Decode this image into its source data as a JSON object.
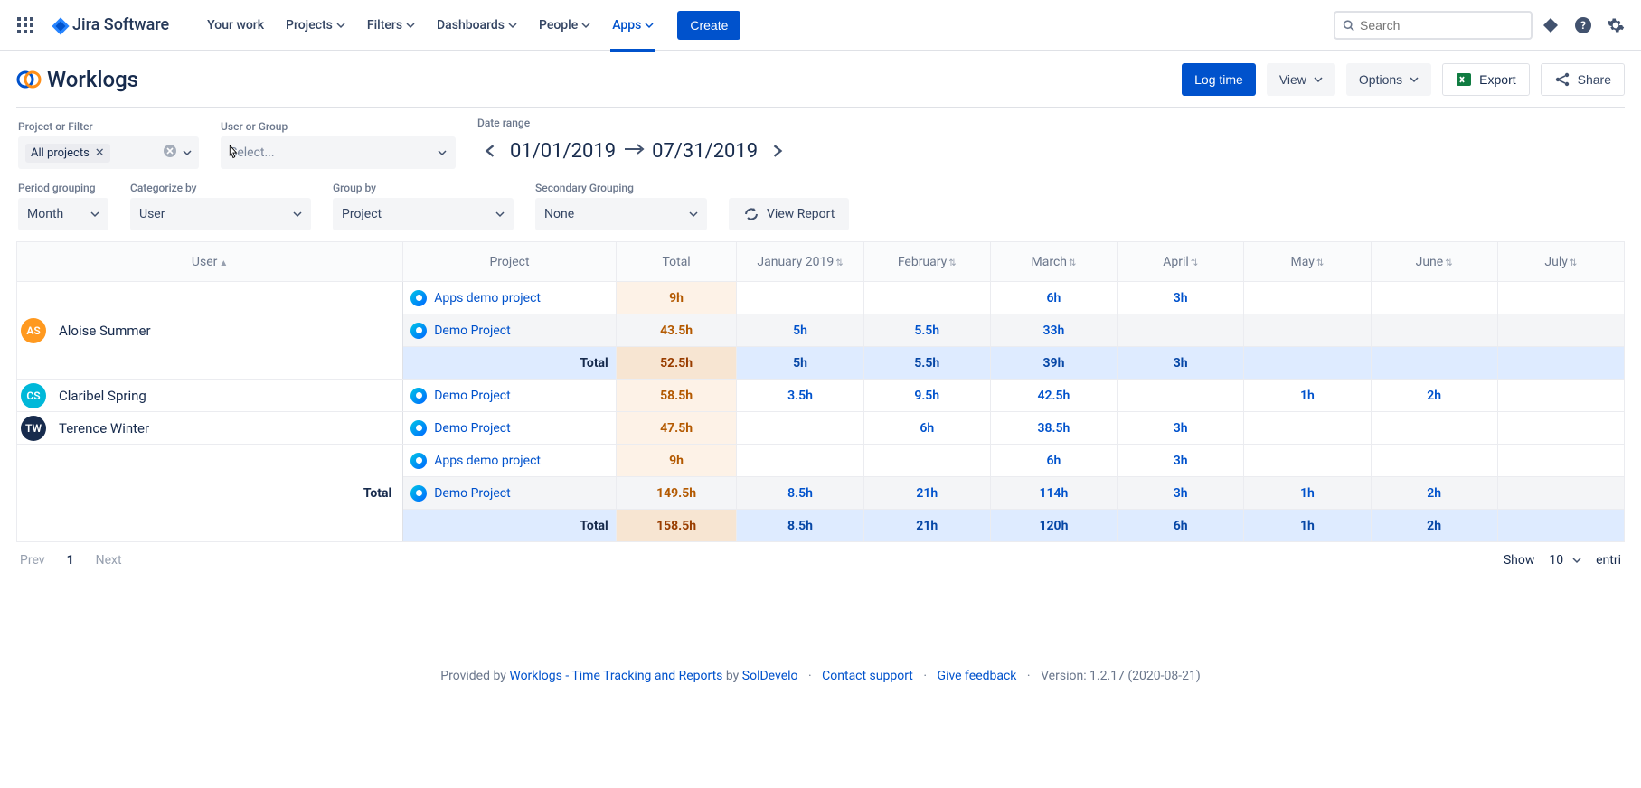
{
  "nav": {
    "product_name": "Jira Software",
    "links": {
      "your_work": "Your work",
      "projects": "Projects",
      "filters": "Filters",
      "dashboards": "Dashboards",
      "people": "People",
      "apps": "Apps"
    },
    "create": "Create",
    "search_placeholder": "Search"
  },
  "header": {
    "title": "Worklogs",
    "actions": {
      "log_time": "Log time",
      "view": "View",
      "options": "Options",
      "export": "Export",
      "share": "Share"
    }
  },
  "toolbar": {
    "project_filter_label": "Project or Filter",
    "project_filter_chip": "All projects",
    "user_group_label": "User or Group",
    "user_group_placeholder": "Select...",
    "date_range_label": "Date range",
    "date_from": "01/01/2019",
    "date_to": "07/31/2019",
    "period_label": "Period grouping",
    "period_value": "Month",
    "categorize_label": "Categorize by",
    "categorize_value": "User",
    "groupby_label": "Group by",
    "groupby_value": "Project",
    "group2_label": "Secondary Grouping",
    "group2_value": "None",
    "view_report": "View Report"
  },
  "table": {
    "headers": {
      "user": "User",
      "project": "Project",
      "total": "Total",
      "months": [
        "January 2019",
        "February",
        "March",
        "April",
        "May",
        "June",
        "July"
      ]
    },
    "groups": [
      {
        "user": "Aloise Summer",
        "avatar_text": "AS",
        "avatar_class": "av-orange",
        "projects": [
          {
            "name": "Apps demo project",
            "total": "9h",
            "m": [
              "",
              "",
              "6h",
              "3h",
              "",
              "",
              ""
            ]
          },
          {
            "name": "Demo Project",
            "total": "43.5h",
            "m": [
              "5h",
              "5.5h",
              "33h",
              "",
              "",
              "",
              ""
            ]
          }
        ],
        "subtotal": {
          "label": "Total",
          "total": "52.5h",
          "m": [
            "5h",
            "5.5h",
            "39h",
            "3h",
            "",
            "",
            ""
          ]
        }
      },
      {
        "user": "Claribel Spring",
        "avatar_text": "CS",
        "avatar_class": "av-teal",
        "projects": [
          {
            "name": "Demo Project",
            "total": "58.5h",
            "m": [
              "3.5h",
              "9.5h",
              "42.5h",
              "",
              "1h",
              "2h",
              ""
            ]
          }
        ]
      },
      {
        "user": "Terence Winter",
        "avatar_text": "TW",
        "avatar_class": "av-dark",
        "projects": [
          {
            "name": "Demo Project",
            "total": "47.5h",
            "m": [
              "",
              "6h",
              "38.5h",
              "3h",
              "",
              "",
              ""
            ]
          }
        ]
      }
    ],
    "grand": {
      "label": "Total",
      "projects": [
        {
          "name": "Apps demo project",
          "total": "9h",
          "m": [
            "",
            "",
            "6h",
            "3h",
            "",
            "",
            ""
          ]
        },
        {
          "name": "Demo Project",
          "total": "149.5h",
          "m": [
            "8.5h",
            "21h",
            "114h",
            "3h",
            "1h",
            "2h",
            ""
          ]
        }
      ],
      "subtotal": {
        "label": "Total",
        "total": "158.5h",
        "m": [
          "8.5h",
          "21h",
          "120h",
          "6h",
          "1h",
          "2h",
          ""
        ]
      }
    }
  },
  "pagination": {
    "prev": "Prev",
    "current": "1",
    "next": "Next",
    "show": "Show",
    "size": "10",
    "entries": "entri"
  },
  "footer": {
    "provided_by": "Provided by",
    "wl_link": "Worklogs - Time Tracking and Reports",
    "by": "by",
    "soldevelo": "SolDevelo",
    "contact": "Contact support",
    "feedback": "Give feedback",
    "version": "Version: 1.2.17 (2020-08-21)"
  }
}
